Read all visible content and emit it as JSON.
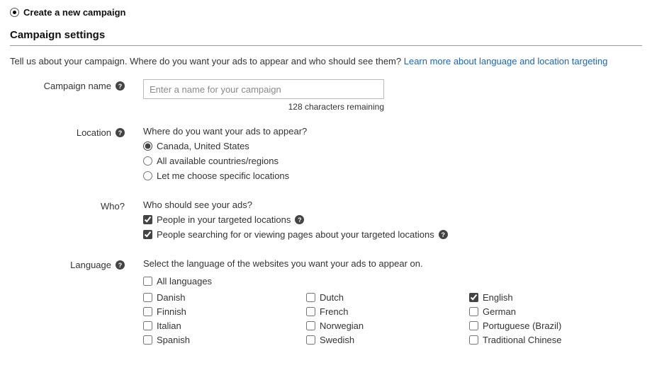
{
  "step_title": "Create a new campaign",
  "section_title": "Campaign settings",
  "intro_text": "Tell us about your campaign. Where do you want your ads to appear and who should see them? ",
  "intro_link": "Learn more about language and location targeting",
  "campaign_name": {
    "label": "Campaign name",
    "placeholder": "Enter a name for your campaign",
    "value": "",
    "counter": "128 characters remaining"
  },
  "location": {
    "label": "Location",
    "question": "Where do you want your ads to appear?",
    "options": [
      {
        "label": "Canada, United States",
        "checked": true
      },
      {
        "label": "All available countries/regions",
        "checked": false
      },
      {
        "label": "Let me choose specific locations",
        "checked": false
      }
    ]
  },
  "who": {
    "label": "Who?",
    "question": "Who should see your ads?",
    "options": [
      {
        "label": "People in your targeted locations",
        "checked": true,
        "help": true
      },
      {
        "label": "People searching for or viewing pages about your targeted locations",
        "checked": true,
        "help": true
      }
    ]
  },
  "language": {
    "label": "Language",
    "question": "Select the language of the websites you want your ads to appear on.",
    "all_languages": {
      "label": "All languages",
      "checked": false
    },
    "col1": [
      {
        "label": "Danish",
        "checked": false
      },
      {
        "label": "Finnish",
        "checked": false
      },
      {
        "label": "Italian",
        "checked": false
      },
      {
        "label": "Spanish",
        "checked": false
      }
    ],
    "col2": [
      {
        "label": "Dutch",
        "checked": false
      },
      {
        "label": "French",
        "checked": false
      },
      {
        "label": "Norwegian",
        "checked": false
      },
      {
        "label": "Swedish",
        "checked": false
      }
    ],
    "col3": [
      {
        "label": "English",
        "checked": true
      },
      {
        "label": "German",
        "checked": false
      },
      {
        "label": "Portuguese (Brazil)",
        "checked": false
      },
      {
        "label": "Traditional Chinese",
        "checked": false
      }
    ]
  }
}
